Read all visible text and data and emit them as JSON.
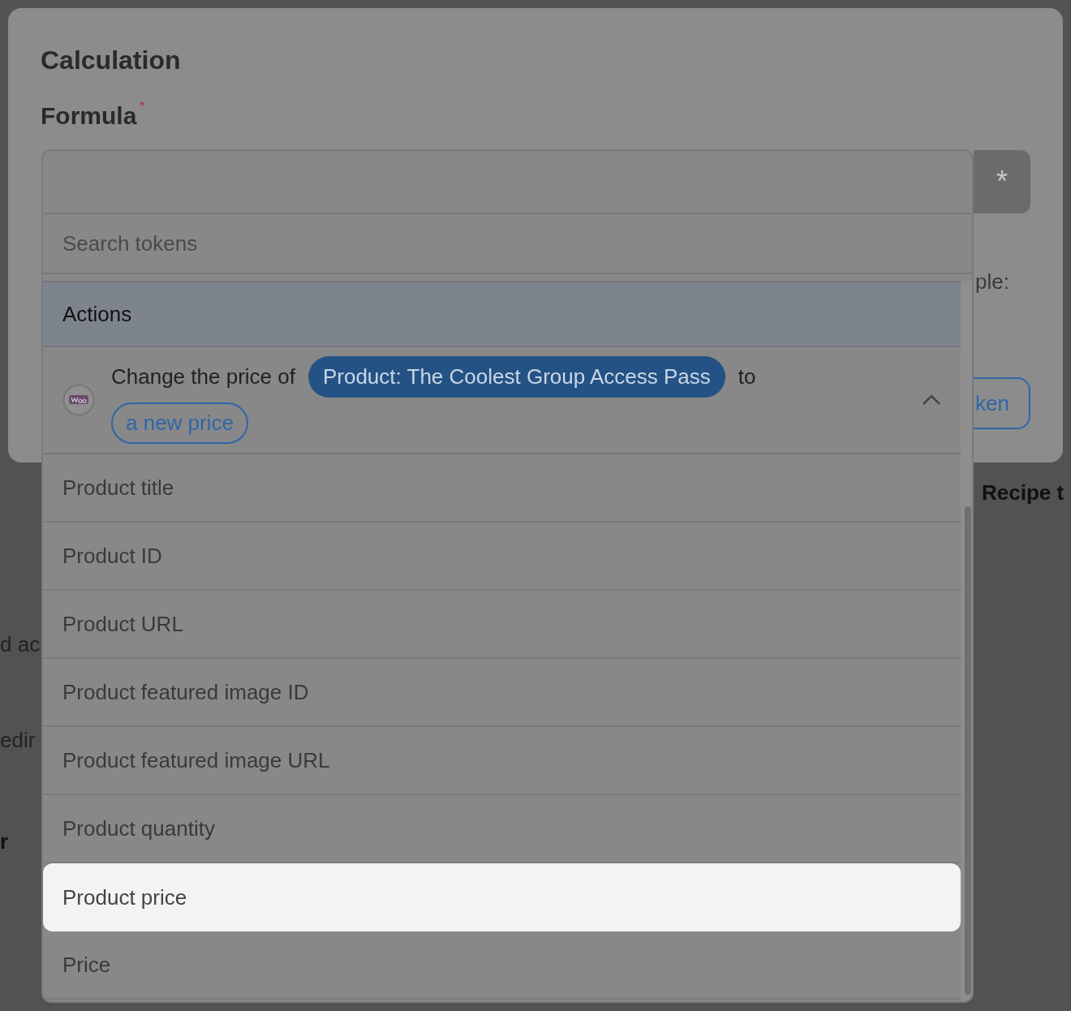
{
  "background": {
    "texts": [
      {
        "text": "d ac",
        "kind": "plain"
      },
      {
        "text": "edir",
        "kind": "plain"
      },
      {
        "text": "r",
        "kind": "bold"
      },
      {
        "text": "Recipe t",
        "kind": "bold"
      }
    ]
  },
  "modal": {
    "title": "Calculation",
    "formula_label": "Formula",
    "required": true,
    "insert_button": "*",
    "hint": "ple:",
    "token_button": "ken"
  },
  "dropdown": {
    "search_placeholder": "Search tokens",
    "group": "Actions",
    "action": {
      "prefix": "Change the price of",
      "token": "Product: The Coolest Group Access Pass",
      "middle": "to",
      "value_token": "a new price",
      "expanded": true
    },
    "items": [
      {
        "label": "Product title",
        "selected": false
      },
      {
        "label": "Product ID",
        "selected": false
      },
      {
        "label": "Product URL",
        "selected": false
      },
      {
        "label": "Product featured image ID",
        "selected": false
      },
      {
        "label": "Product featured image URL",
        "selected": false
      },
      {
        "label": "Product quantity",
        "selected": false
      },
      {
        "label": "Product price",
        "selected": true
      },
      {
        "label": "Price",
        "selected": false
      }
    ]
  }
}
